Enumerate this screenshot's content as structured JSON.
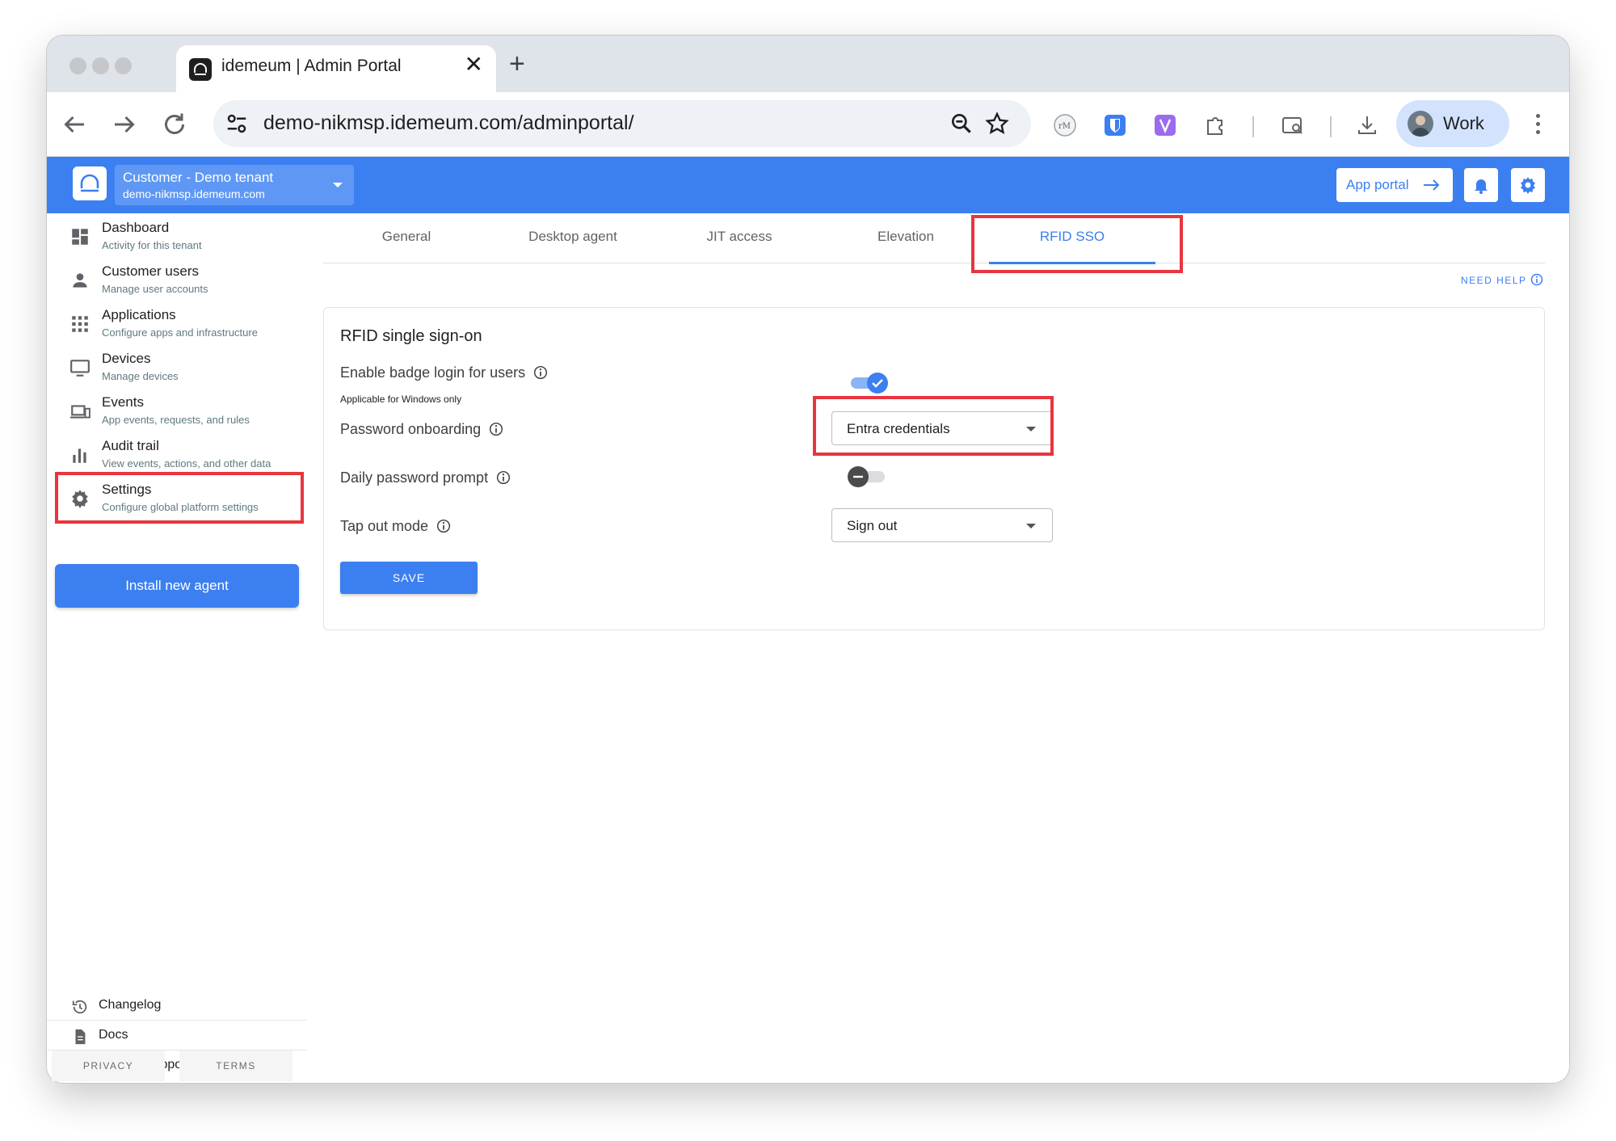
{
  "browser": {
    "tab_title": "idemeum | Admin Portal",
    "tab_close": "✕",
    "new_tab": "+",
    "url": "demo-nikmsp.idemeum.com/adminportal/",
    "profile_label": "Work"
  },
  "header": {
    "tenant_name": "Customer - Demo tenant",
    "tenant_domain": "demo-nikmsp.idemeum.com",
    "app_portal_label": "App portal",
    "accent_color": "#3b7ff0"
  },
  "sidebar": {
    "items": [
      {
        "title": "Dashboard",
        "subtitle": "Activity for this tenant",
        "icon": "dashboard-icon"
      },
      {
        "title": "Customer users",
        "subtitle": "Manage user accounts",
        "icon": "person-icon"
      },
      {
        "title": "Applications",
        "subtitle": "Configure apps and infrastructure",
        "icon": "apps-grid-icon"
      },
      {
        "title": "Devices",
        "subtitle": "Manage devices",
        "icon": "monitor-icon"
      },
      {
        "title": "Events",
        "subtitle": "App events, requests, and rules",
        "icon": "devices-icon"
      },
      {
        "title": "Audit trail",
        "subtitle": "View events, actions, and other data",
        "icon": "bar-chart-icon"
      },
      {
        "title": "Settings",
        "subtitle": "Configure global platform settings",
        "icon": "gear-icon"
      }
    ],
    "install_button": "Install new agent",
    "footer": [
      {
        "label": "Changelog",
        "icon": "history-icon"
      },
      {
        "label": "Docs",
        "icon": "document-icon"
      },
      {
        "label": "Contact support",
        "icon": "help-icon"
      }
    ],
    "privacy": "PRIVACY",
    "terms": "TERMS"
  },
  "main": {
    "tabs": [
      {
        "label": "General"
      },
      {
        "label": "Desktop agent"
      },
      {
        "label": "JIT access"
      },
      {
        "label": "Elevation"
      },
      {
        "label": "RFID SSO"
      }
    ],
    "active_tab": "RFID SSO",
    "need_help": "NEED HELP",
    "card": {
      "title": "RFID single sign-on",
      "enable_badge_label": "Enable badge login for users",
      "enable_badge_sub": "Applicable for Windows only",
      "enable_badge_value": true,
      "password_onboarding_label": "Password onboarding",
      "password_onboarding_value": "Entra credentials",
      "daily_prompt_label": "Daily password prompt",
      "daily_prompt_value": false,
      "tap_out_label": "Tap out mode",
      "tap_out_value": "Sign out",
      "save_label": "SAVE"
    }
  },
  "annotation_color": "#e8353f"
}
